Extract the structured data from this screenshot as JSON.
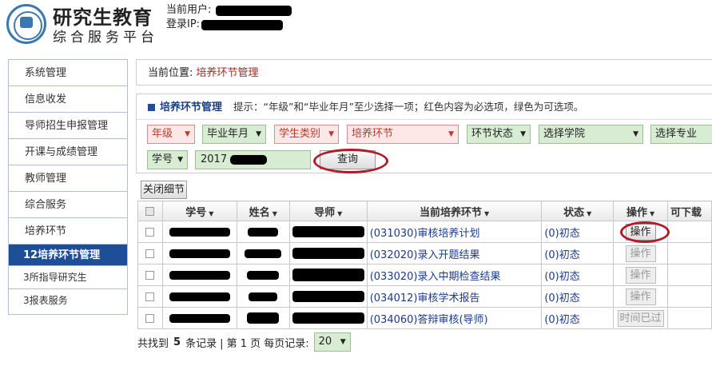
{
  "header": {
    "title": "研究生教育",
    "subtitle": "综合服务平台",
    "user_label": "当前用户:",
    "ip_label": "登录IP:"
  },
  "sidebar": {
    "items": [
      {
        "label": "系统管理"
      },
      {
        "label": "信息收发"
      },
      {
        "label": "导师招生申报管理"
      },
      {
        "label": "开课与成绩管理"
      },
      {
        "label": "教师管理"
      },
      {
        "label": "综合服务"
      },
      {
        "label": "培养环节"
      },
      {
        "label": "12培养环节管理"
      },
      {
        "label": "3所指导研究生"
      },
      {
        "label": "3报表服务"
      }
    ]
  },
  "breadcrumb": {
    "prefix": "当前位置:",
    "current": "培养环节管理"
  },
  "panel": {
    "title": "培养环节管理",
    "hint": "提示：“年级”和“毕业年月”至少选择一项；红色内容为必选项，绿色为可选项。"
  },
  "filters": {
    "grade": "年级",
    "grad_month": "毕业年月",
    "student_type": "学生类别",
    "stage": "培养环节",
    "stage_status": "环节状态",
    "college": "选择学院",
    "major": "选择专业",
    "id_type": "学号",
    "id_value": "2017",
    "query_label": "查询"
  },
  "close_detail_label": "关闭细节",
  "table": {
    "headers": {
      "id": "学号",
      "name": "姓名",
      "advisor": "导师",
      "stage": "当前培养环节",
      "status": "状态",
      "op": "操作",
      "download": "可下载"
    },
    "rows": [
      {
        "stage": "(031030)审核培养计划",
        "status": "(0)初态",
        "op": "操作"
      },
      {
        "stage": "(032020)录入开题结果",
        "status": "(0)初态",
        "op": "操作"
      },
      {
        "stage": "(033020)录入中期检查结果",
        "status": "(0)初态",
        "op": "操作"
      },
      {
        "stage": "(034012)审核学术报告",
        "status": "(0)初态",
        "op": "操作"
      },
      {
        "stage": "(034060)答辩审核(导师)",
        "status": "(0)初态",
        "op": "时间已过"
      }
    ]
  },
  "footer": {
    "found_prefix": "共找到",
    "count": "5",
    "found_suffix": "条记录",
    "page_info": "| 第 1 页 每页记录:",
    "page_size": "20"
  },
  "colors": {
    "primary_blue": "#1f4e99",
    "required_red": "#c0392b",
    "optional_green": "#d8ecd3",
    "annotation_ellipse": "#b21b2a"
  }
}
